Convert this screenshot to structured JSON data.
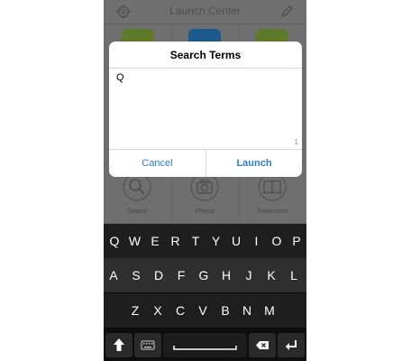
{
  "app": {
    "title": "Launch Center",
    "grid": [
      {
        "label": "Search",
        "icon": "magnifier-icon"
      },
      {
        "label": "Photos",
        "icon": "camera-icon"
      },
      {
        "label": "Bookmarks",
        "icon": "book-icon"
      }
    ]
  },
  "dialog": {
    "title": "Search Terms",
    "input_value": "Q",
    "char_count": "1",
    "cancel_label": "Cancel",
    "launch_label": "Launch"
  },
  "keyboard": {
    "row1": [
      "Q",
      "W",
      "E",
      "R",
      "T",
      "Y",
      "U",
      "I",
      "O",
      "P"
    ],
    "row2": [
      "A",
      "S",
      "D",
      "F",
      "G",
      "H",
      "J",
      "K",
      "L"
    ],
    "row3": [
      "Z",
      "X",
      "C",
      "V",
      "B",
      "N",
      "M"
    ]
  },
  "colors": {
    "accent": "#2a7fd4",
    "keyboard_bg": "#141414",
    "dim_bg": "#6f6f6f"
  }
}
